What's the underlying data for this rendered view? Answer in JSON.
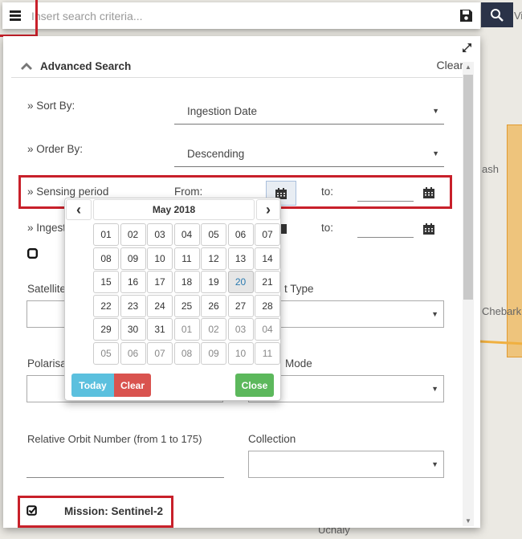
{
  "search": {
    "placeholder": "Insert search criteria...",
    "value": ""
  },
  "advanced_search": {
    "title": "Advanced Search",
    "clear_label": "Clear"
  },
  "sort_by": {
    "label": "» Sort By:",
    "value": "Ingestion Date"
  },
  "order_by": {
    "label": "» Order By:",
    "value": "Descending"
  },
  "sensing_period": {
    "label": "» Sensing period",
    "from_label": "From:",
    "to_label": "to:"
  },
  "ingestion_period": {
    "label": "» Ingesti",
    "to_label": "to:"
  },
  "fields": {
    "satellite_label": "Satellite",
    "product_type_label": "t Type",
    "polarisation_label": "Polarisa",
    "sensor_mode_label": "Mode",
    "relative_orbit_label": "Relative Orbit Number (from 1 to 175)",
    "collection_label": "Collection"
  },
  "mission": {
    "label": "Mission: Sentinel-2",
    "checked": true
  },
  "datepicker": {
    "month_label": "May 2018",
    "prev": "‹",
    "next": "›",
    "selected_day": "20",
    "weeks": [
      [
        {
          "d": "01"
        },
        {
          "d": "02"
        },
        {
          "d": "03"
        },
        {
          "d": "04"
        },
        {
          "d": "05"
        },
        {
          "d": "06"
        },
        {
          "d": "07"
        }
      ],
      [
        {
          "d": "08"
        },
        {
          "d": "09"
        },
        {
          "d": "10"
        },
        {
          "d": "11"
        },
        {
          "d": "12"
        },
        {
          "d": "13"
        },
        {
          "d": "14"
        }
      ],
      [
        {
          "d": "15"
        },
        {
          "d": "16"
        },
        {
          "d": "17"
        },
        {
          "d": "18"
        },
        {
          "d": "19"
        },
        {
          "d": "20",
          "sel": true
        },
        {
          "d": "21"
        }
      ],
      [
        {
          "d": "22"
        },
        {
          "d": "23"
        },
        {
          "d": "24"
        },
        {
          "d": "25"
        },
        {
          "d": "26"
        },
        {
          "d": "27"
        },
        {
          "d": "28"
        }
      ],
      [
        {
          "d": "29"
        },
        {
          "d": "30"
        },
        {
          "d": "31"
        },
        {
          "d": "01",
          "muted": true
        },
        {
          "d": "02",
          "muted": true
        },
        {
          "d": "03",
          "muted": true
        },
        {
          "d": "04",
          "muted": true
        }
      ],
      [
        {
          "d": "05",
          "muted": true
        },
        {
          "d": "06",
          "muted": true
        },
        {
          "d": "07",
          "muted": true
        },
        {
          "d": "08",
          "muted": true
        },
        {
          "d": "09",
          "muted": true
        },
        {
          "d": "10",
          "muted": true
        },
        {
          "d": "11",
          "muted": true
        }
      ]
    ],
    "today_label": "Today",
    "clear_label": "Clear",
    "close_label": "Close"
  },
  "map_labels": {
    "top": "Vis",
    "ash": "ash",
    "chebarkul": "Chebarku",
    "uchaly": "Uchaly"
  },
  "colors": {
    "search_button": "#2b3348",
    "highlight": "#c8202a",
    "today": "#5bc0de",
    "clear": "#d9534f",
    "close": "#5cb85c",
    "selected_day_text": "#2a7ab0"
  }
}
